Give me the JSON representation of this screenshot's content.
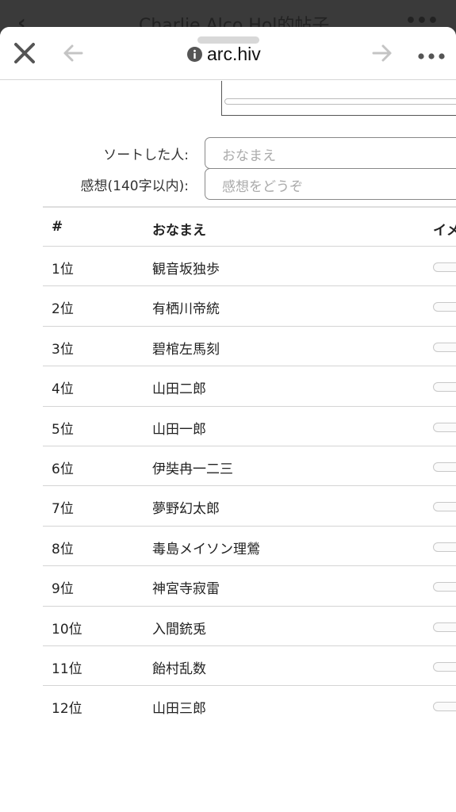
{
  "behind": {
    "title": "Charlie Alco Hol的帖子",
    "back_glyph": "‹",
    "more_glyph": "•••"
  },
  "browser": {
    "url": "arc.hiv",
    "icons": [
      "close-icon",
      "back-arrow-icon",
      "info-icon",
      "forward-arrow-icon",
      "more-icon"
    ]
  },
  "form": {
    "sorter_label": "ソートした人:",
    "sorter_placeholder": "おなまえ",
    "comment_label": "感想(140字以内):",
    "comment_placeholder": "感想をどうぞ"
  },
  "table": {
    "headers": {
      "rank": "#",
      "name": "おなまえ",
      "image": "イメ"
    },
    "rows": [
      {
        "rank": "1位",
        "name": "観音坂独歩"
      },
      {
        "rank": "2位",
        "name": "有栖川帝統"
      },
      {
        "rank": "3位",
        "name": "碧棺左馬刻"
      },
      {
        "rank": "4位",
        "name": "山田二郎"
      },
      {
        "rank": "5位",
        "name": "山田一郎"
      },
      {
        "rank": "6位",
        "name": "伊奘冉一二三"
      },
      {
        "rank": "7位",
        "name": "夢野幻太郎"
      },
      {
        "rank": "8位",
        "name": "毒島メイソン理鶯"
      },
      {
        "rank": "9位",
        "name": "神宮寺寂雷"
      },
      {
        "rank": "10位",
        "name": "入間銃兎"
      },
      {
        "rank": "11位",
        "name": "飴村乱数"
      },
      {
        "rank": "12位",
        "name": "山田三郎"
      }
    ]
  },
  "colors": {
    "backdrop": "#3a3a3a",
    "sheet": "#ffffff",
    "divider": "#d4d4d4"
  }
}
